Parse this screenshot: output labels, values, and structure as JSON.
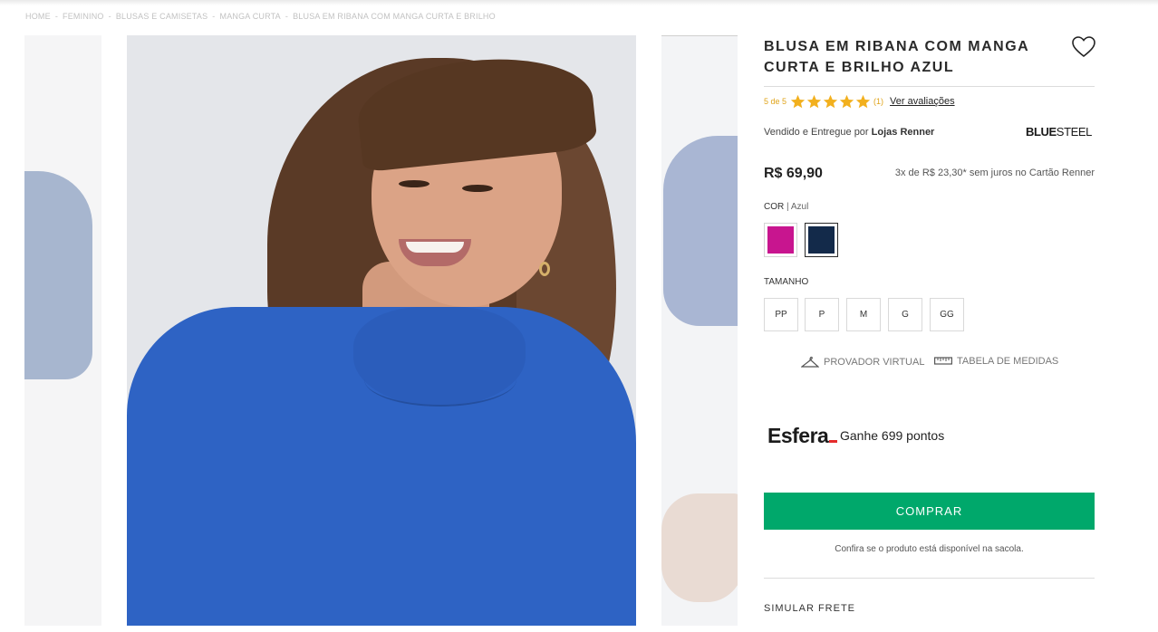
{
  "breadcrumb": [
    "HOME",
    "FEMININO",
    "BLUSAS E CAMISETAS",
    "MANGA CURTA",
    "BLUSA EM RIBANA COM MANGA CURTA E BRILHO"
  ],
  "breadcrumb_separator": "-",
  "product": {
    "title": "BLUSA EM RIBANA COM MANGA CURTA E BRILHO AZUL",
    "rating_text": "5 de 5",
    "rating_value": 5,
    "rating_max": 5,
    "review_count": "(1)",
    "reviews_link": "Ver avaliações",
    "seller_prefix": "Vendido e Entregue por",
    "seller_name": "Lojas Renner",
    "brand_bold": "BLUE",
    "brand_light": "STEEL",
    "price": "R$ 69,90",
    "installments": "3x de R$ 23,30* sem juros no Cartão Renner"
  },
  "color": {
    "label": "COR",
    "separator": "|",
    "selected": "Azul",
    "swatches": [
      {
        "name": "Rosa",
        "hex": "#c8158f",
        "selected": false
      },
      {
        "name": "Azul",
        "hex": "#132a4a",
        "selected": true
      }
    ]
  },
  "size": {
    "label": "TAMANHO",
    "options": [
      "PP",
      "P",
      "M",
      "G",
      "GG"
    ]
  },
  "tools": {
    "virtual_fitting": "PROVADOR VIRTUAL",
    "size_chart": "TABELA DE MEDIDAS"
  },
  "esfera": {
    "logo": "Esfera",
    "points_text": "Ganhe 699 pontos"
  },
  "buy_button": "COMPRAR",
  "availability_note": "Confira se o produto está disponível na sacola.",
  "shipping_label": "SIMULAR FRETE",
  "colors": {
    "accent_green": "#00a86b",
    "star_gold": "#f2b01e",
    "shirt_blue": "#2e63c4"
  },
  "icons": [
    "heart-icon",
    "star-icon",
    "hanger-icon",
    "ruler-icon"
  ]
}
